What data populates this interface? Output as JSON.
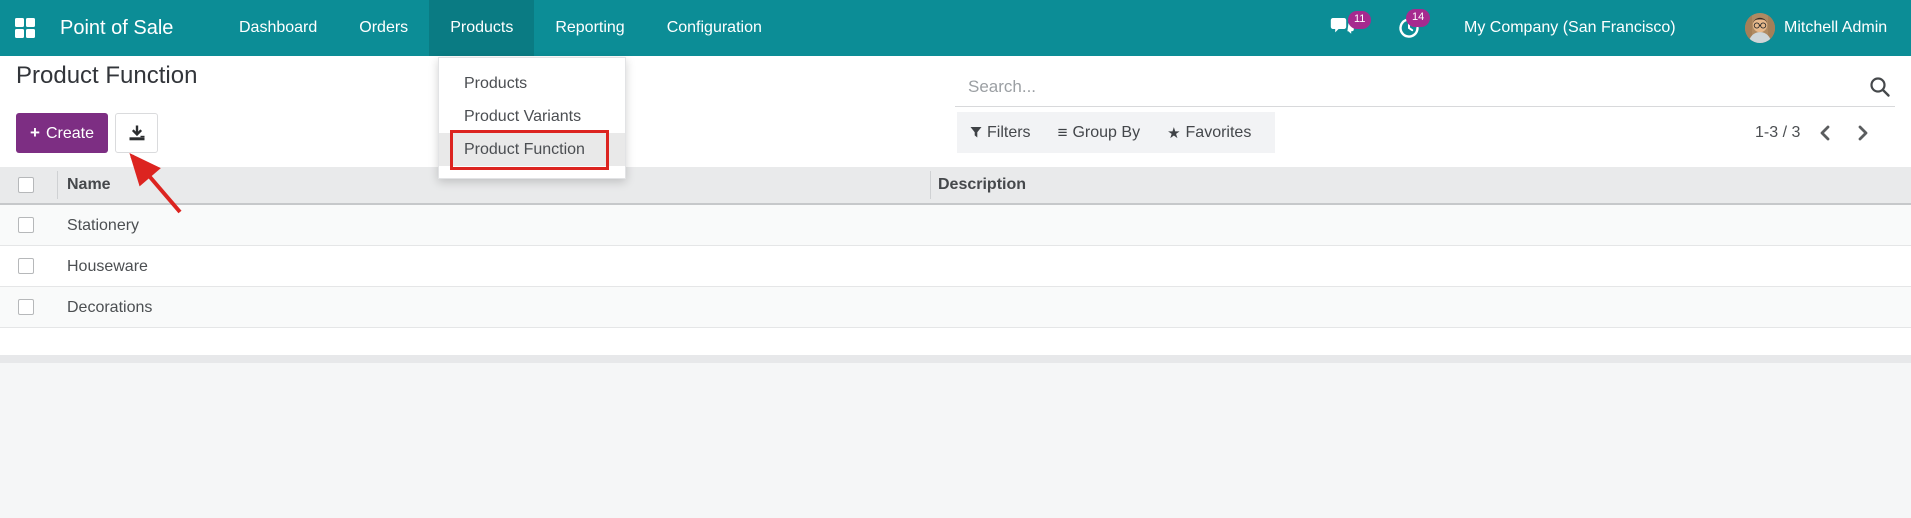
{
  "navbar": {
    "app_name": "Point of Sale",
    "menu": [
      "Dashboard",
      "Orders",
      "Products",
      "Reporting",
      "Configuration"
    ],
    "active_menu": "Products",
    "messages_count": "11",
    "activities_count": "14",
    "company": "My Company (San Francisco)",
    "user_name": "Mitchell Admin"
  },
  "products_dropdown": {
    "items": [
      "Products",
      "Product Variants",
      "Product Function"
    ],
    "highlighted_item": "Product Function"
  },
  "page": {
    "title": "Product Function",
    "create_button": "Create",
    "plus_glyph": "+"
  },
  "search": {
    "placeholder": "Search..."
  },
  "filter_bar": {
    "filters": "Filters",
    "group_by": "Group By",
    "favorites": "Favorites",
    "group_by_glyph": "≡",
    "favorites_glyph": "★"
  },
  "pager": {
    "range": "1-3 / 3"
  },
  "table": {
    "columns": {
      "name": "Name",
      "description": "Description"
    },
    "rows": [
      {
        "name": "Stationery",
        "description": ""
      },
      {
        "name": "Houseware",
        "description": ""
      },
      {
        "name": "Decorations",
        "description": ""
      }
    ]
  },
  "colors": {
    "navbar_teal": "#0c8d96",
    "active_menu_teal": "#0b7e88",
    "create_purple": "#7d2e83",
    "badge_magenta": "#a62a8f",
    "annotation_red": "#dc2420"
  }
}
